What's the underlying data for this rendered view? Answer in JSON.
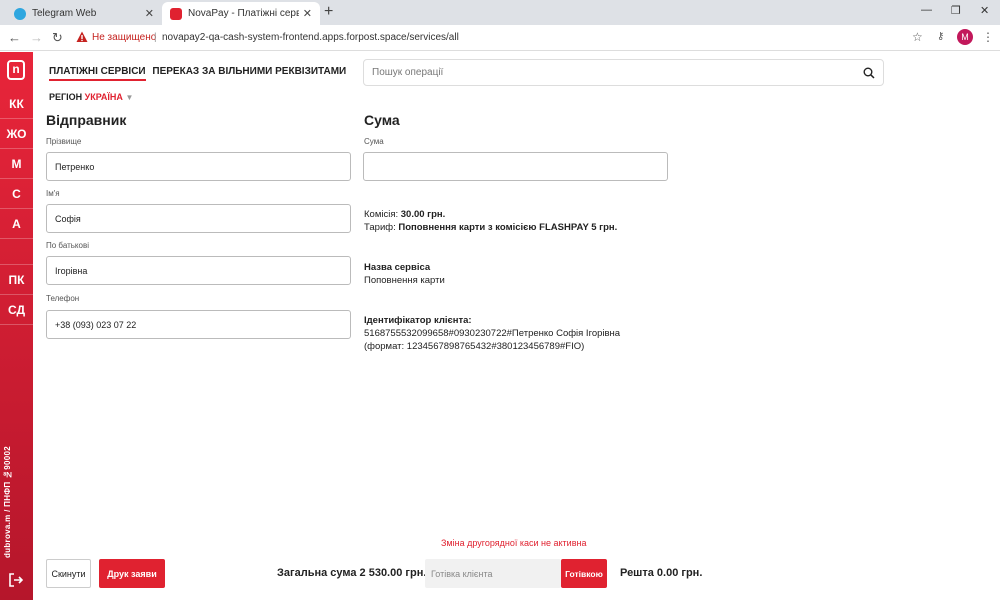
{
  "browser": {
    "tabs": [
      {
        "title": "Telegram Web"
      },
      {
        "title": "NovaPay - Платіжні сервіси"
      }
    ],
    "address": {
      "security_label": "Не защищено",
      "url": "novapay2-qa-cash-system-frontend.apps.forpost.space/services/all"
    },
    "profile_initial": "M"
  },
  "sidebar": {
    "logo": "n",
    "items": [
      "КК",
      "ЖО",
      "М",
      "С",
      "А",
      "",
      "ПК",
      "СД"
    ],
    "user_info": "dubrova.m / ПНФП №90002"
  },
  "nav": {
    "tabs": [
      "ПЛАТІЖНІ СЕРВІСИ",
      "ПЕРЕКАЗ ЗА ВІЛЬНИМИ РЕКВІЗИТАМИ"
    ],
    "region_label": "РЕГІОН",
    "region_value": "УКРАЇНА",
    "search_placeholder": "Пошук операції"
  },
  "sender": {
    "heading": "Відправник",
    "fields": [
      {
        "label": "Прізвище",
        "value": "Петренко"
      },
      {
        "label": "Ім'я",
        "value": "Софія"
      },
      {
        "label": "По батькові",
        "value": "Ігорівна"
      },
      {
        "label": "Телефон",
        "value": "+38 (093) 023 07 22"
      }
    ]
  },
  "amount": {
    "heading": "Сума",
    "label": "Сума",
    "value": "",
    "commission_label": "Комісія:",
    "commission_value": "30.00 грн.",
    "tariff_label": "Тариф:",
    "tariff_value": "Поповнення карти з комісією FLASHPAY 5 грн.",
    "service_name_label": "Назва сервіса",
    "service_name_value": "Поповнення карти",
    "client_id_label": "Ідентифікатор клієнта:",
    "client_id_value": "5168755532099658#0930230722#Петренко Софія Ігорівна",
    "client_id_format": "(формат: 1234567898765432#380123456789#FIO)"
  },
  "footer": {
    "warning": "Зміна другорядної каси не активна",
    "reset_label": "Скинути",
    "print_label": "Друк заяви",
    "total_text": "Загальна сума 2 530.00 грн.",
    "cash_placeholder": "Готівка клієнта",
    "cash_button": "Готівкою",
    "change_text": "Решта 0.00 грн."
  }
}
